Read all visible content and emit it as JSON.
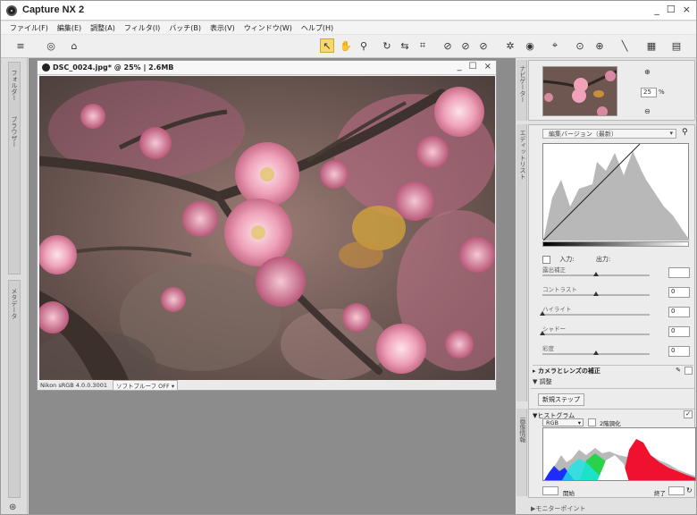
{
  "app": {
    "title": "Capture NX 2",
    "min": "_",
    "max": "☐",
    "close": "×"
  },
  "menu": [
    "ファイル(F)",
    "編集(E)",
    "調整(A)",
    "フィルタ(I)",
    "バッチ(B)",
    "表示(V)",
    "ウィンドウ(W)",
    "ヘルプ(H)"
  ],
  "left_dock": {
    "top_label": "フォルダー",
    "second_label": "ブラウザー",
    "bottom_label": "メタデータ"
  },
  "document": {
    "title": "DSC_0024.jpg* @ 25% | 2.6MB",
    "profile": "Nikon sRGB 4.0.0.3001",
    "softproof": "ソフトプルーフ OFF"
  },
  "right_panel": {
    "navigator_label": "ナビゲーター",
    "zoom_value": "25",
    "zoom_unit": "%",
    "editlist_label": "エディットリスト",
    "version_dropdown": "編集バージョン（最新）",
    "curve": {
      "input_label": "入力:",
      "output_label": "出力:"
    },
    "sliders": [
      {
        "label": "露出補正",
        "value": "",
        "knob": 0.5
      },
      {
        "label": "コントラスト",
        "value": "0",
        "knob": 0.5
      },
      {
        "label": "ハイライト",
        "value": "0",
        "knob": 0.0
      },
      {
        "label": "シャドー",
        "value": "0",
        "knob": 0.0
      },
      {
        "label": "彩度",
        "value": "0",
        "knob": 0.5
      }
    ],
    "camera_lens_section": "カメラとレンズの補正",
    "adjust_section": "▼ 調整",
    "new_step_button": "新規ステップ",
    "histogram_section": "▼ヒストグラム",
    "histogram_channel": "RGB",
    "histogram_checkbox_label": "2階調化",
    "histogram_side_label": "画像情報",
    "range_start_label": "開始",
    "range_end_label": "終了",
    "monitor_point": "▶モニターポイント"
  }
}
